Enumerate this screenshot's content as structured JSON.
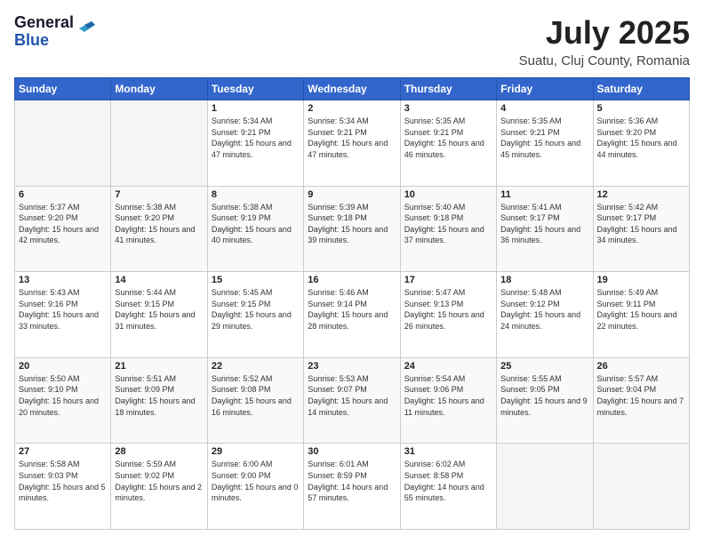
{
  "logo": {
    "general": "General",
    "blue": "Blue"
  },
  "header": {
    "month": "July 2025",
    "location": "Suatu, Cluj County, Romania"
  },
  "weekdays": [
    "Sunday",
    "Monday",
    "Tuesday",
    "Wednesday",
    "Thursday",
    "Friday",
    "Saturday"
  ],
  "weeks": [
    [
      {
        "day": "",
        "sunrise": "",
        "sunset": "",
        "daylight": ""
      },
      {
        "day": "",
        "sunrise": "",
        "sunset": "",
        "daylight": ""
      },
      {
        "day": "1",
        "sunrise": "Sunrise: 5:34 AM",
        "sunset": "Sunset: 9:21 PM",
        "daylight": "Daylight: 15 hours and 47 minutes."
      },
      {
        "day": "2",
        "sunrise": "Sunrise: 5:34 AM",
        "sunset": "Sunset: 9:21 PM",
        "daylight": "Daylight: 15 hours and 47 minutes."
      },
      {
        "day": "3",
        "sunrise": "Sunrise: 5:35 AM",
        "sunset": "Sunset: 9:21 PM",
        "daylight": "Daylight: 15 hours and 46 minutes."
      },
      {
        "day": "4",
        "sunrise": "Sunrise: 5:35 AM",
        "sunset": "Sunset: 9:21 PM",
        "daylight": "Daylight: 15 hours and 45 minutes."
      },
      {
        "day": "5",
        "sunrise": "Sunrise: 5:36 AM",
        "sunset": "Sunset: 9:20 PM",
        "daylight": "Daylight: 15 hours and 44 minutes."
      }
    ],
    [
      {
        "day": "6",
        "sunrise": "Sunrise: 5:37 AM",
        "sunset": "Sunset: 9:20 PM",
        "daylight": "Daylight: 15 hours and 42 minutes."
      },
      {
        "day": "7",
        "sunrise": "Sunrise: 5:38 AM",
        "sunset": "Sunset: 9:20 PM",
        "daylight": "Daylight: 15 hours and 41 minutes."
      },
      {
        "day": "8",
        "sunrise": "Sunrise: 5:38 AM",
        "sunset": "Sunset: 9:19 PM",
        "daylight": "Daylight: 15 hours and 40 minutes."
      },
      {
        "day": "9",
        "sunrise": "Sunrise: 5:39 AM",
        "sunset": "Sunset: 9:18 PM",
        "daylight": "Daylight: 15 hours and 39 minutes."
      },
      {
        "day": "10",
        "sunrise": "Sunrise: 5:40 AM",
        "sunset": "Sunset: 9:18 PM",
        "daylight": "Daylight: 15 hours and 37 minutes."
      },
      {
        "day": "11",
        "sunrise": "Sunrise: 5:41 AM",
        "sunset": "Sunset: 9:17 PM",
        "daylight": "Daylight: 15 hours and 36 minutes."
      },
      {
        "day": "12",
        "sunrise": "Sunrise: 5:42 AM",
        "sunset": "Sunset: 9:17 PM",
        "daylight": "Daylight: 15 hours and 34 minutes."
      }
    ],
    [
      {
        "day": "13",
        "sunrise": "Sunrise: 5:43 AM",
        "sunset": "Sunset: 9:16 PM",
        "daylight": "Daylight: 15 hours and 33 minutes."
      },
      {
        "day": "14",
        "sunrise": "Sunrise: 5:44 AM",
        "sunset": "Sunset: 9:15 PM",
        "daylight": "Daylight: 15 hours and 31 minutes."
      },
      {
        "day": "15",
        "sunrise": "Sunrise: 5:45 AM",
        "sunset": "Sunset: 9:15 PM",
        "daylight": "Daylight: 15 hours and 29 minutes."
      },
      {
        "day": "16",
        "sunrise": "Sunrise: 5:46 AM",
        "sunset": "Sunset: 9:14 PM",
        "daylight": "Daylight: 15 hours and 28 minutes."
      },
      {
        "day": "17",
        "sunrise": "Sunrise: 5:47 AM",
        "sunset": "Sunset: 9:13 PM",
        "daylight": "Daylight: 15 hours and 26 minutes."
      },
      {
        "day": "18",
        "sunrise": "Sunrise: 5:48 AM",
        "sunset": "Sunset: 9:12 PM",
        "daylight": "Daylight: 15 hours and 24 minutes."
      },
      {
        "day": "19",
        "sunrise": "Sunrise: 5:49 AM",
        "sunset": "Sunset: 9:11 PM",
        "daylight": "Daylight: 15 hours and 22 minutes."
      }
    ],
    [
      {
        "day": "20",
        "sunrise": "Sunrise: 5:50 AM",
        "sunset": "Sunset: 9:10 PM",
        "daylight": "Daylight: 15 hours and 20 minutes."
      },
      {
        "day": "21",
        "sunrise": "Sunrise: 5:51 AM",
        "sunset": "Sunset: 9:09 PM",
        "daylight": "Daylight: 15 hours and 18 minutes."
      },
      {
        "day": "22",
        "sunrise": "Sunrise: 5:52 AM",
        "sunset": "Sunset: 9:08 PM",
        "daylight": "Daylight: 15 hours and 16 minutes."
      },
      {
        "day": "23",
        "sunrise": "Sunrise: 5:53 AM",
        "sunset": "Sunset: 9:07 PM",
        "daylight": "Daylight: 15 hours and 14 minutes."
      },
      {
        "day": "24",
        "sunrise": "Sunrise: 5:54 AM",
        "sunset": "Sunset: 9:06 PM",
        "daylight": "Daylight: 15 hours and 11 minutes."
      },
      {
        "day": "25",
        "sunrise": "Sunrise: 5:55 AM",
        "sunset": "Sunset: 9:05 PM",
        "daylight": "Daylight: 15 hours and 9 minutes."
      },
      {
        "day": "26",
        "sunrise": "Sunrise: 5:57 AM",
        "sunset": "Sunset: 9:04 PM",
        "daylight": "Daylight: 15 hours and 7 minutes."
      }
    ],
    [
      {
        "day": "27",
        "sunrise": "Sunrise: 5:58 AM",
        "sunset": "Sunset: 9:03 PM",
        "daylight": "Daylight: 15 hours and 5 minutes."
      },
      {
        "day": "28",
        "sunrise": "Sunrise: 5:59 AM",
        "sunset": "Sunset: 9:02 PM",
        "daylight": "Daylight: 15 hours and 2 minutes."
      },
      {
        "day": "29",
        "sunrise": "Sunrise: 6:00 AM",
        "sunset": "Sunset: 9:00 PM",
        "daylight": "Daylight: 15 hours and 0 minutes."
      },
      {
        "day": "30",
        "sunrise": "Sunrise: 6:01 AM",
        "sunset": "Sunset: 8:59 PM",
        "daylight": "Daylight: 14 hours and 57 minutes."
      },
      {
        "day": "31",
        "sunrise": "Sunrise: 6:02 AM",
        "sunset": "Sunset: 8:58 PM",
        "daylight": "Daylight: 14 hours and 55 minutes."
      },
      {
        "day": "",
        "sunrise": "",
        "sunset": "",
        "daylight": ""
      },
      {
        "day": "",
        "sunrise": "",
        "sunset": "",
        "daylight": ""
      }
    ]
  ]
}
